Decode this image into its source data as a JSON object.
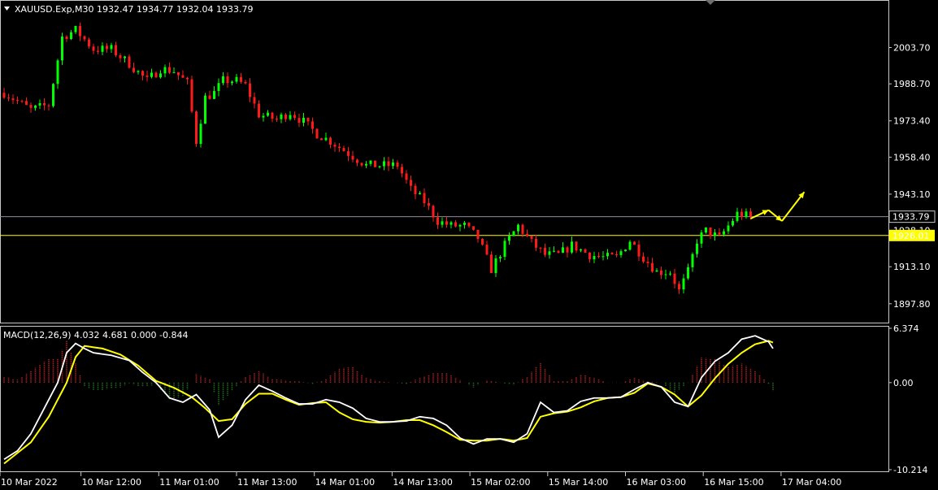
{
  "header": {
    "symbol_line": "XAUUSD.Exp,M30  1932.47 1934.77 1932.04 1933.79"
  },
  "indicator": {
    "macd_line": "MACD(12,26,9) 4.032 4.681 0.000 -0.844"
  },
  "colors": {
    "background": "#000000",
    "bull": "#00ff00",
    "bear": "#ff1a1a",
    "signal": "#ffff00",
    "macd_main": "#ffffff",
    "hist_pos": "#b22222",
    "hist_neg": "#1e6b1e",
    "level_line": "#ffff00",
    "current_line": "#8c8c9c",
    "arrow": "#ffff00"
  },
  "chart_data": [
    {
      "type": "candlestick",
      "symbol": "XAUUSD.Exp",
      "timeframe": "M30",
      "ylim": [
        1890.0,
        2020.0
      ],
      "y_ticks": [
        "2003.70",
        "1988.70",
        "1973.40",
        "1958.40",
        "1943.10",
        "1928.10",
        "1913.10",
        "1897.80"
      ],
      "y_tick_values": [
        2003.7,
        1988.7,
        1973.4,
        1958.4,
        1943.1,
        1928.1,
        1913.1,
        1897.8
      ],
      "x_ticks": [
        "10 Mar 2022",
        "10 Mar 12:00",
        "11 Mar 01:00",
        "11 Mar 13:00",
        "14 Mar 01:00",
        "14 Mar 13:00",
        "15 Mar 02:00",
        "15 Mar 14:00",
        "16 Mar 03:00",
        "16 Mar 15:00",
        "17 Mar 04:00"
      ],
      "current_price": "1933.79",
      "current_price_value": 1933.79,
      "level_price": "1926.01",
      "level_price_value": 1926.01,
      "close_path": [
        [
          0,
          1985
        ],
        [
          6,
          1978
        ],
        [
          10,
          1980
        ],
        [
          13,
          2008
        ],
        [
          16,
          2011
        ],
        [
          20,
          2003
        ],
        [
          24,
          2003
        ],
        [
          28,
          1997
        ],
        [
          32,
          1990
        ],
        [
          35,
          1995
        ],
        [
          38,
          1994
        ],
        [
          41,
          1989
        ],
        [
          43,
          1965
        ],
        [
          45,
          1983
        ],
        [
          47,
          1985
        ],
        [
          49,
          1990
        ],
        [
          52,
          1990
        ],
        [
          54,
          1988
        ],
        [
          57,
          1976
        ],
        [
          61,
          1974
        ],
        [
          64,
          1977
        ],
        [
          67,
          1973
        ],
        [
          70,
          1968
        ],
        [
          73,
          1965
        ],
        [
          77,
          1960
        ],
        [
          81,
          1955
        ],
        [
          85,
          1955
        ],
        [
          88,
          1955
        ],
        [
          91,
          1945
        ],
        [
          94,
          1940
        ],
        [
          97,
          1932
        ],
        [
          100,
          1930
        ],
        [
          103,
          1930
        ],
        [
          106,
          1925
        ],
        [
          109,
          1912
        ],
        [
          112,
          1922
        ],
        [
          115,
          1930
        ],
        [
          118,
          1923
        ],
        [
          121,
          1918
        ],
        [
          124,
          1918
        ],
        [
          127,
          1922
        ],
        [
          131,
          1918
        ],
        [
          134,
          1917
        ],
        [
          137,
          1917
        ],
        [
          140,
          1924
        ],
        [
          143,
          1917
        ],
        [
          146,
          1911
        ],
        [
          149,
          1911
        ],
        [
          151,
          1903
        ],
        [
          153,
          1911
        ],
        [
          155,
          1924
        ],
        [
          157,
          1928
        ],
        [
          160,
          1925
        ],
        [
          162,
          1930
        ],
        [
          164,
          1935
        ],
        [
          167,
          1933.79
        ]
      ],
      "arrows": [
        {
          "from": [
            167,
            1933.0
          ],
          "to": [
            171,
            1936.5
          ]
        },
        {
          "from": [
            171,
            1936.5
          ],
          "to": [
            174,
            1932.0
          ]
        },
        {
          "from": [
            174,
            1932.0
          ],
          "to": [
            179,
            1944.0
          ]
        }
      ]
    },
    {
      "type": "macd",
      "params": "12,26,9",
      "ylim": [
        -10.214,
        6.374
      ],
      "y_ticks": [
        "6.374",
        "0.00",
        "-10.214"
      ],
      "y_tick_values": [
        6.374,
        0.0,
        -10.214
      ],
      "main": [
        [
          0,
          -9.0
        ],
        [
          3,
          -8.0
        ],
        [
          6,
          -6.0
        ],
        [
          9,
          -3.0
        ],
        [
          12,
          0.0
        ],
        [
          14,
          3.5
        ],
        [
          16,
          4.6
        ],
        [
          18,
          4.0
        ],
        [
          20,
          3.5
        ],
        [
          24,
          3.2
        ],
        [
          28,
          2.6
        ],
        [
          31,
          1.2
        ],
        [
          34,
          0.0
        ],
        [
          37,
          -1.8
        ],
        [
          40,
          -2.3
        ],
        [
          43,
          -1.4
        ],
        [
          46,
          -3.2
        ],
        [
          48,
          -6.4
        ],
        [
          51,
          -5.0
        ],
        [
          54,
          -2.0
        ],
        [
          57,
          -0.3
        ],
        [
          60,
          -1.0
        ],
        [
          63,
          -1.8
        ],
        [
          66,
          -2.5
        ],
        [
          69,
          -2.5
        ],
        [
          72,
          -2.0
        ],
        [
          75,
          -2.3
        ],
        [
          78,
          -3.0
        ],
        [
          81,
          -4.2
        ],
        [
          84,
          -4.6
        ],
        [
          87,
          -4.6
        ],
        [
          90,
          -4.5
        ],
        [
          93,
          -4.0
        ],
        [
          96,
          -4.2
        ],
        [
          99,
          -5.0
        ],
        [
          102,
          -6.5
        ],
        [
          105,
          -7.2
        ],
        [
          108,
          -6.6
        ],
        [
          111,
          -6.6
        ],
        [
          114,
          -7.0
        ],
        [
          117,
          -6.0
        ],
        [
          120,
          -2.3
        ],
        [
          123,
          -3.5
        ],
        [
          126,
          -3.3
        ],
        [
          129,
          -2.2
        ],
        [
          132,
          -1.8
        ],
        [
          135,
          -1.8
        ],
        [
          138,
          -1.7
        ],
        [
          141,
          -0.8
        ],
        [
          144,
          0.0
        ],
        [
          147,
          -0.5
        ],
        [
          150,
          -2.3
        ],
        [
          153,
          -2.8
        ],
        [
          156,
          0.6
        ],
        [
          159,
          2.5
        ],
        [
          162,
          3.5
        ],
        [
          165,
          5.1
        ],
        [
          168,
          5.5
        ],
        [
          171,
          4.8
        ],
        [
          172,
          4.0
        ]
      ],
      "signal": [
        [
          0,
          -9.5
        ],
        [
          6,
          -7.0
        ],
        [
          10,
          -4.0
        ],
        [
          14,
          0.0
        ],
        [
          16,
          3.0
        ],
        [
          18,
          4.3
        ],
        [
          22,
          4.0
        ],
        [
          26,
          3.3
        ],
        [
          30,
          2.0
        ],
        [
          34,
          0.2
        ],
        [
          38,
          -0.6
        ],
        [
          42,
          -1.7
        ],
        [
          45,
          -3.0
        ],
        [
          48,
          -4.5
        ],
        [
          51,
          -4.3
        ],
        [
          54,
          -2.5
        ],
        [
          57,
          -1.3
        ],
        [
          60,
          -1.3
        ],
        [
          63,
          -2.0
        ],
        [
          66,
          -2.6
        ],
        [
          69,
          -2.4
        ],
        [
          72,
          -2.3
        ],
        [
          75,
          -3.5
        ],
        [
          78,
          -4.3
        ],
        [
          81,
          -4.6
        ],
        [
          84,
          -4.7
        ],
        [
          87,
          -4.6
        ],
        [
          90,
          -4.4
        ],
        [
          93,
          -4.4
        ],
        [
          96,
          -5.0
        ],
        [
          99,
          -5.8
        ],
        [
          102,
          -6.7
        ],
        [
          105,
          -6.8
        ],
        [
          108,
          -6.8
        ],
        [
          111,
          -6.6
        ],
        [
          114,
          -6.8
        ],
        [
          117,
          -6.5
        ],
        [
          120,
          -4.0
        ],
        [
          123,
          -3.6
        ],
        [
          126,
          -3.4
        ],
        [
          129,
          -2.9
        ],
        [
          132,
          -2.2
        ],
        [
          135,
          -1.8
        ],
        [
          138,
          -1.7
        ],
        [
          141,
          -1.2
        ],
        [
          144,
          -0.1
        ],
        [
          147,
          -0.5
        ],
        [
          150,
          -1.4
        ],
        [
          153,
          -2.8
        ],
        [
          156,
          -1.5
        ],
        [
          159,
          0.5
        ],
        [
          162,
          2.2
        ],
        [
          165,
          3.5
        ],
        [
          168,
          4.5
        ],
        [
          171,
          4.9
        ],
        [
          172,
          4.7
        ]
      ]
    }
  ]
}
